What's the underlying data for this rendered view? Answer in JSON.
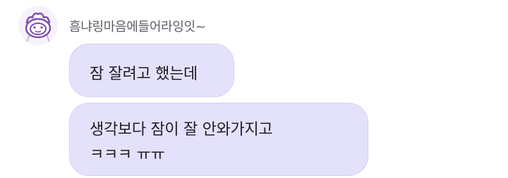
{
  "chat": {
    "sender_name": "흠냐링마음에들어라잉잇~",
    "avatar_icon": "purple-crowned-face-avatar-icon",
    "messages": [
      {
        "lines": [
          "잠 잘려고 했는데"
        ]
      },
      {
        "lines": [
          "생각보다 잠이 잘 안와가지고",
          "ㅋㅋㅋ ㅠㅠ"
        ]
      }
    ]
  },
  "colors": {
    "bubble_bg": "#e4e2fb",
    "bubble_border": "#d2cff3",
    "sender_text": "#5c5c66",
    "message_text": "#1e1e24",
    "avatar_accent": "#7e4ea8"
  }
}
